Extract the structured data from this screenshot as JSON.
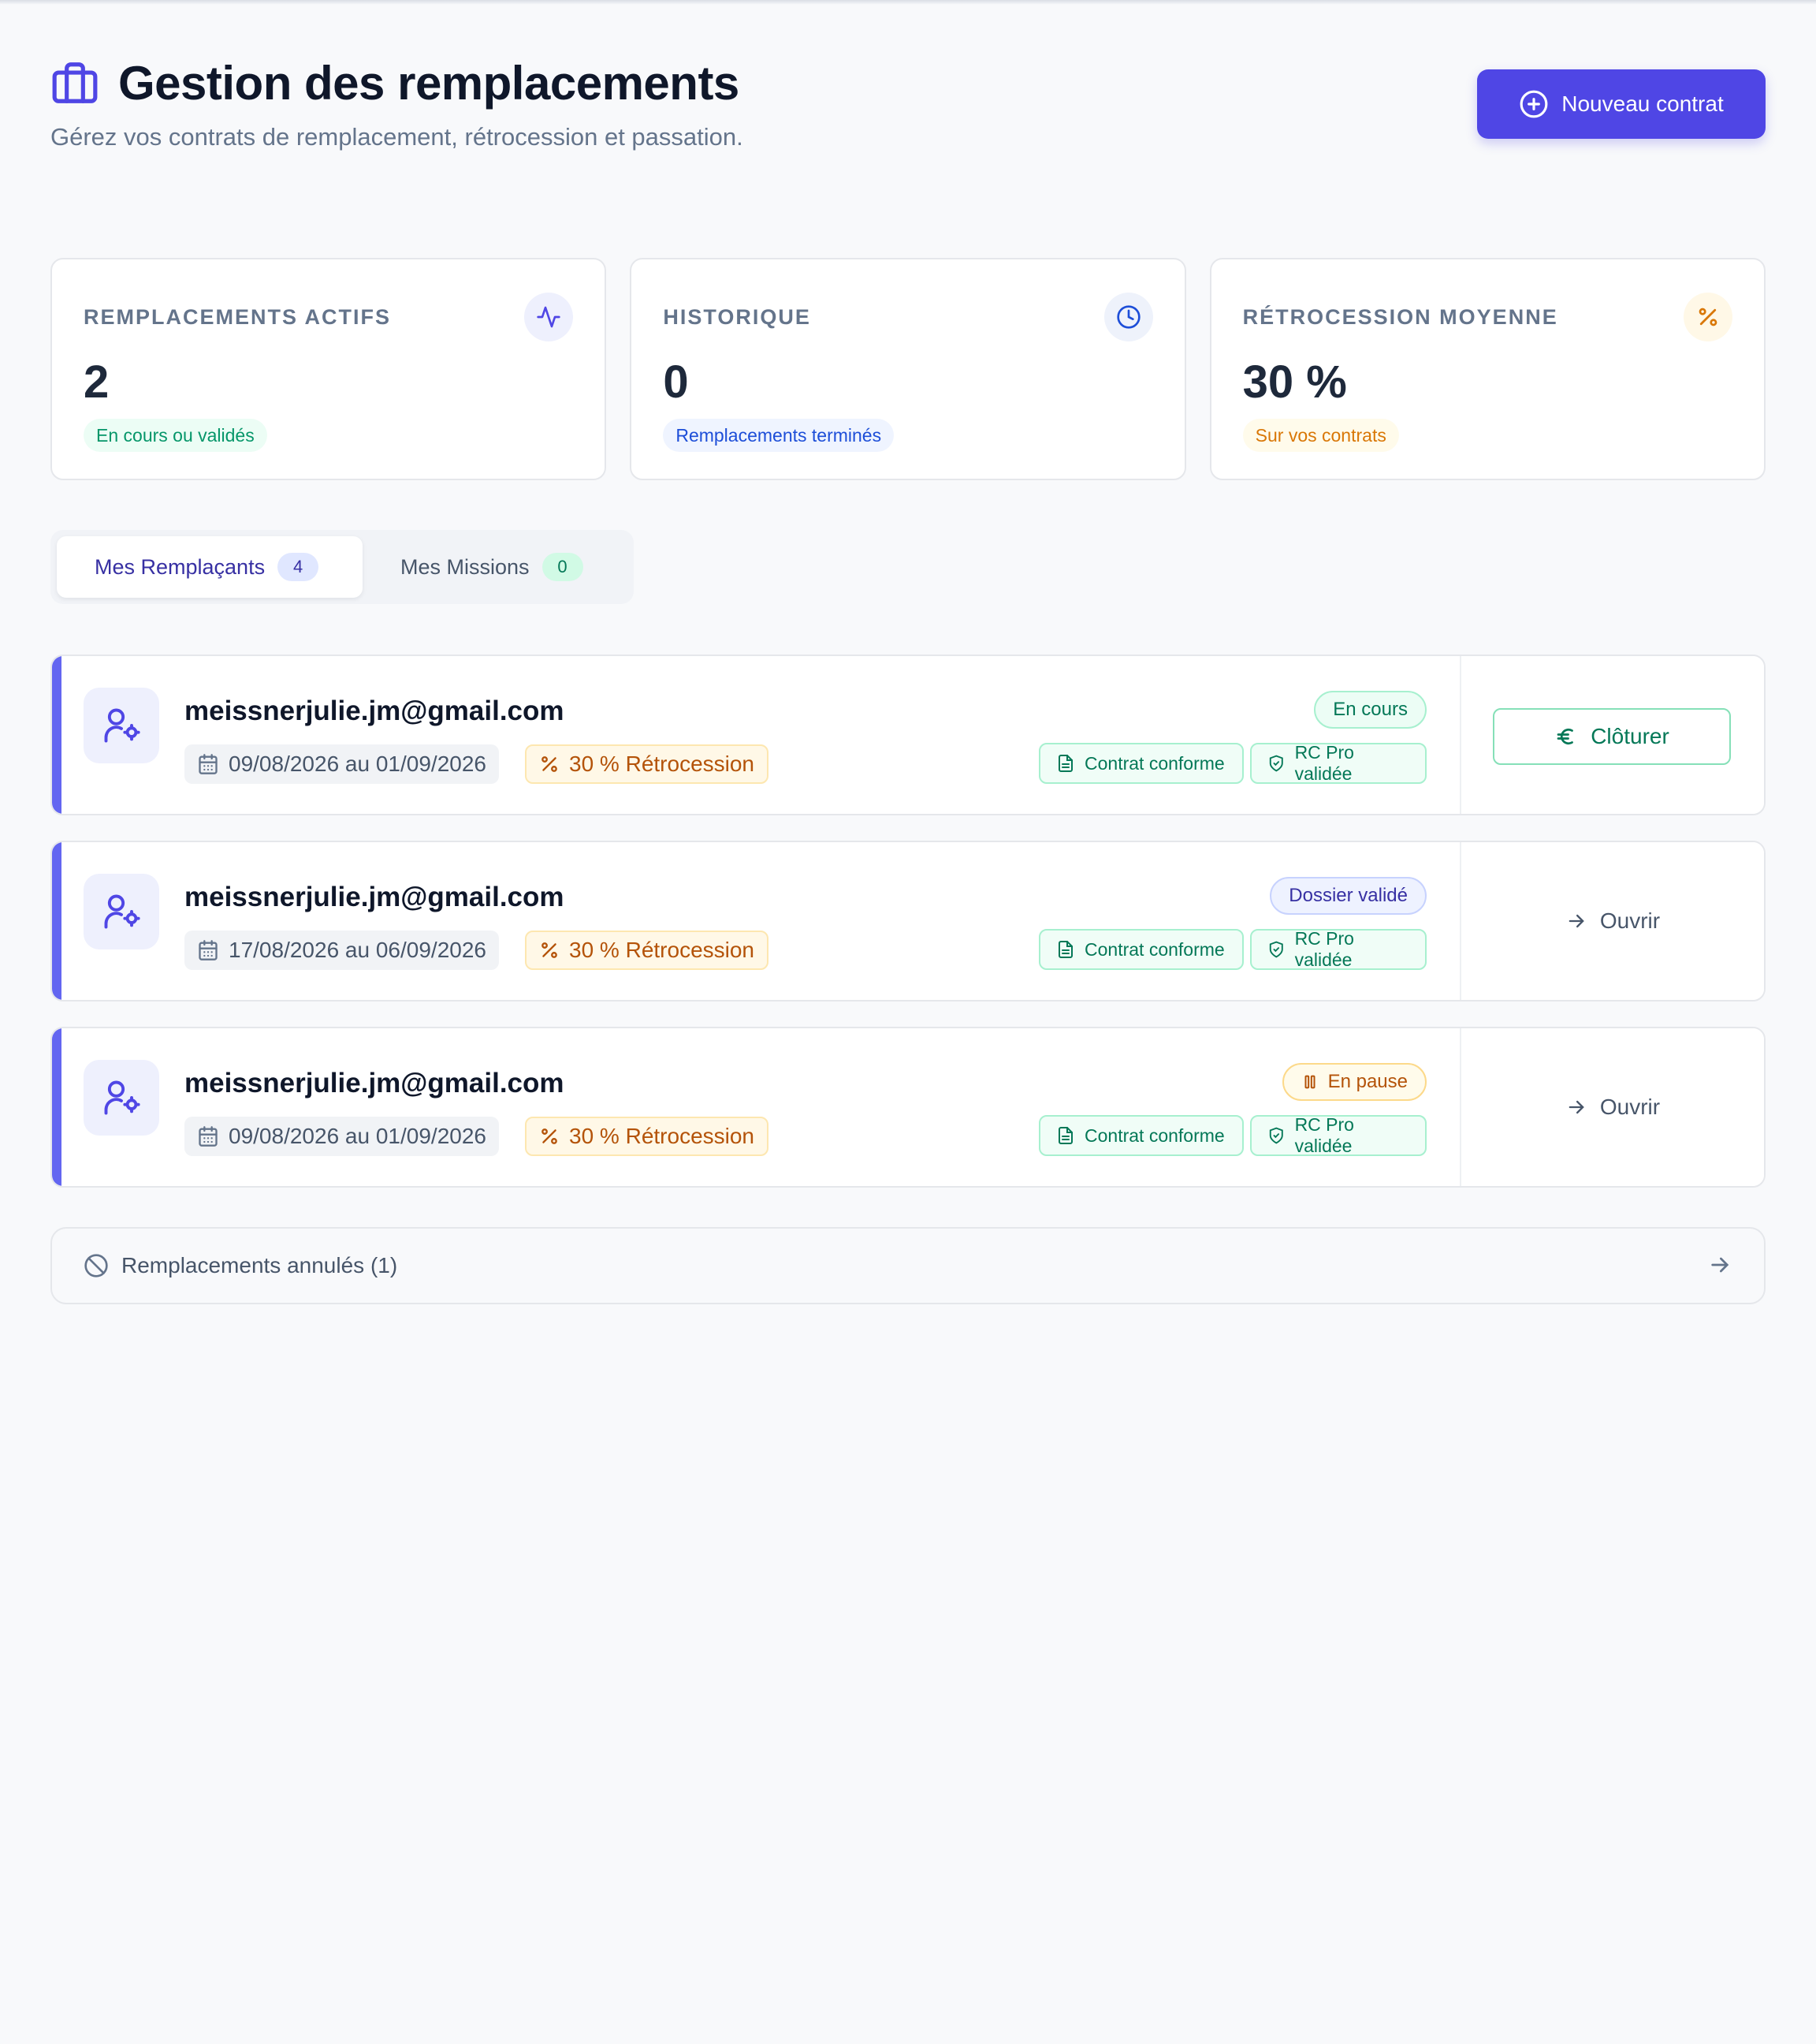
{
  "header": {
    "title": "Gestion des remplacements",
    "subtitle": "Gérez vos contrats de remplacement, rétrocession et passation.",
    "new_button": "Nouveau contrat",
    "title_icon": "briefcase-icon"
  },
  "stats": [
    {
      "label": "REMPLACEMENTS ACTIFS",
      "value": "2",
      "badge": "En cours ou validés",
      "icon": "activity-icon",
      "accent": "#059669"
    },
    {
      "label": "HISTORIQUE",
      "value": "0",
      "badge": "Remplacements terminés",
      "icon": "clock-icon",
      "accent": "#1d4ed8"
    },
    {
      "label": "RÉTROCESSION MOYENNE",
      "value": "30 %",
      "badge": "Sur vos contrats",
      "icon": "percent-icon",
      "accent": "#d97706"
    }
  ],
  "tabs": [
    {
      "label": "Mes Remplaçants",
      "count": "4",
      "active": true
    },
    {
      "label": "Mes Missions",
      "count": "0",
      "active": false
    }
  ],
  "cards": [
    {
      "email": "meissnerjulie.jm@gmail.com",
      "dates": "09/08/2026 au 01/09/2026",
      "retro": "30 % Rétrocession",
      "status": "En cours",
      "doc1": "Contrat conforme",
      "doc2": "RC Pro validée",
      "action": "Clôturer"
    },
    {
      "email": "meissnerjulie.jm@gmail.com",
      "dates": "17/08/2026 au 06/09/2026",
      "retro": "30 % Rétrocession",
      "status": "Dossier validé",
      "doc1": "Contrat conforme",
      "doc2": "RC Pro validée",
      "action": "Ouvrir"
    },
    {
      "email": "meissnerjulie.jm@gmail.com",
      "dates": "09/08/2026 au 01/09/2026",
      "retro": "30 % Rétrocession",
      "status": "En pause",
      "doc1": "Contrat conforme",
      "doc2": "RC Pro validée",
      "action": "Ouvrir"
    }
  ],
  "cancelled": {
    "label": "Remplacements annulés (1)"
  },
  "colors": {
    "primary": "#4f46e5",
    "success": "#047857",
    "warning": "#b45309",
    "info": "#3730a3"
  }
}
